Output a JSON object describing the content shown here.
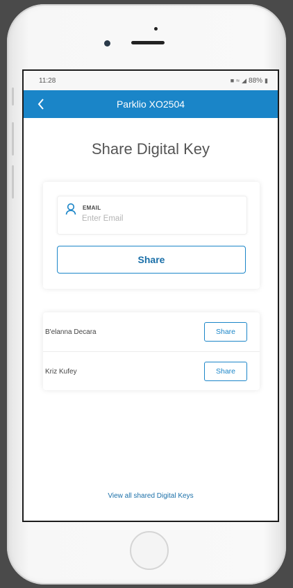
{
  "status_bar": {
    "time": "11:28",
    "battery": "88%"
  },
  "app_bar": {
    "back_icon": "chevron-left-icon",
    "title": "Parklio XO2504"
  },
  "page": {
    "heading": "Share Digital Key"
  },
  "email_form": {
    "icon": "person-icon",
    "label": "EMAIL",
    "value": "",
    "placeholder": "Enter Email",
    "share_label": "Share"
  },
  "contacts": [
    {
      "name": "B'elanna Decara",
      "share_label": "Share"
    },
    {
      "name": "Kriz Kufey",
      "share_label": "Share"
    }
  ],
  "footer": {
    "view_all_label": "View all shared Digital Keys"
  },
  "colors": {
    "accent": "#1a85c8",
    "app_bar": "#1a85c8",
    "heading_text": "#555555"
  }
}
